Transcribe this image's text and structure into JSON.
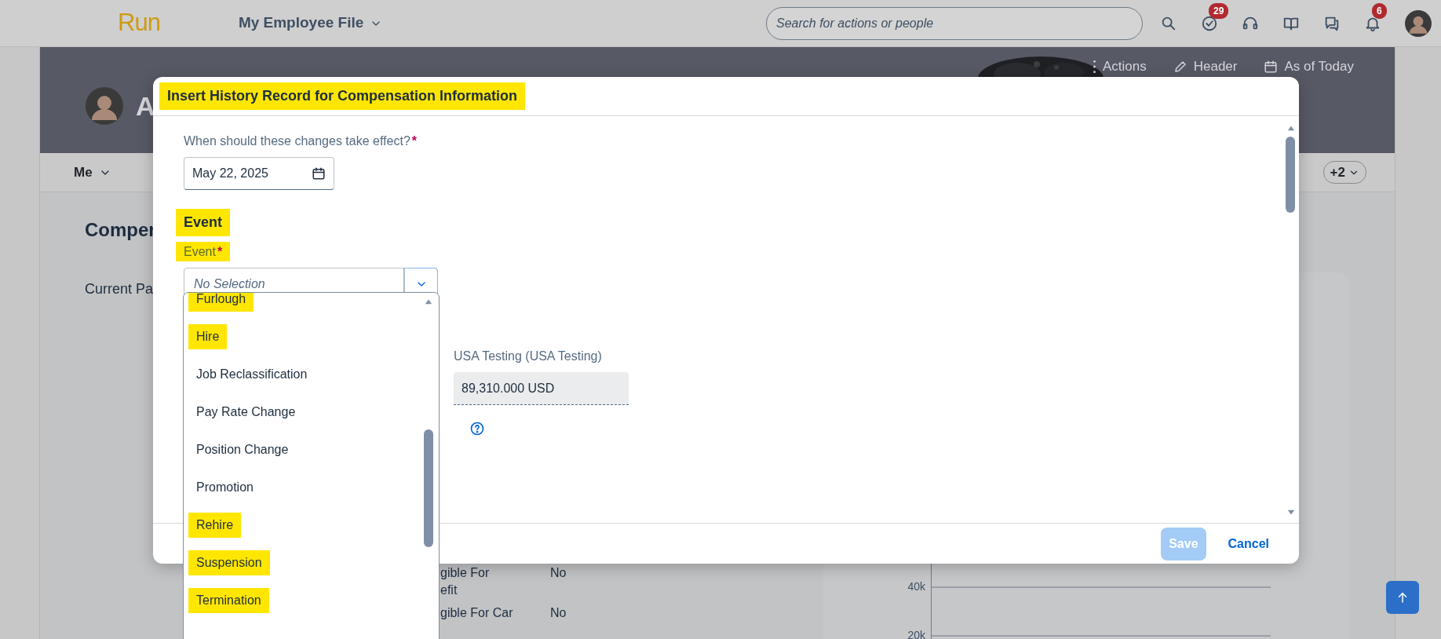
{
  "top_bar": {
    "logo": "Run",
    "app_menu": "My Employee File",
    "search": {
      "placeholder": "Search for actions or people"
    },
    "icons": [
      {
        "kind": "search"
      },
      {
        "kind": "tasks",
        "badge": "29"
      },
      {
        "kind": "headset"
      },
      {
        "kind": "book"
      },
      {
        "kind": "chat"
      },
      {
        "kind": "bell",
        "badge": "6"
      },
      {
        "kind": "avatar"
      }
    ]
  },
  "profile_header": {
    "name": "A",
    "actions": [
      {
        "kind": "more",
        "label": "Actions"
      },
      {
        "kind": "edit",
        "label": "Header"
      },
      {
        "kind": "calendar",
        "label": "As of Today"
      }
    ]
  },
  "tab_bar": {
    "tabs": [
      {
        "label": "Me"
      }
    ],
    "overflow": "+2"
  },
  "content": {
    "section_title": "Comper",
    "current_pay_label": "Current Pa",
    "rows": [
      {
        "label": "gible For\nefit",
        "value": "No"
      },
      {
        "label": "gible For Car",
        "value": "No"
      }
    ],
    "chart_ticks": [
      "40k",
      "20k"
    ]
  },
  "modal": {
    "title": "Insert History Record for Compensation Information",
    "highlighted": true,
    "date_field": {
      "label": "When should these changes take effect?",
      "required_mark": "*",
      "value": "May 22, 2025"
    },
    "event_section": {
      "heading": "Event",
      "heading_highlighted": true,
      "label": "Event",
      "label_highlighted": true,
      "required_mark": "*",
      "select": {
        "placeholder": "No Selection",
        "expanded": true,
        "options": [
          {
            "label": "Furlough",
            "highlighted": true
          },
          {
            "label": "Hire",
            "highlighted": true
          },
          {
            "label": "Job Reclassification",
            "highlighted": false
          },
          {
            "label": "Pay Rate Change",
            "highlighted": false
          },
          {
            "label": "Position Change",
            "highlighted": false
          },
          {
            "label": "Promotion",
            "highlighted": false
          },
          {
            "label": "Rehire",
            "highlighted": true
          },
          {
            "label": "Suspension",
            "highlighted": true
          },
          {
            "label": "Termination",
            "highlighted": true
          }
        ]
      }
    },
    "amount_field": {
      "label": "USA Testing (USA Testing)",
      "value": "89,310.000 USD"
    },
    "buttons": [
      {
        "kind": "primary",
        "label": "Save",
        "disabled": true
      },
      {
        "kind": "link",
        "label": "Cancel",
        "disabled": false
      }
    ]
  }
}
